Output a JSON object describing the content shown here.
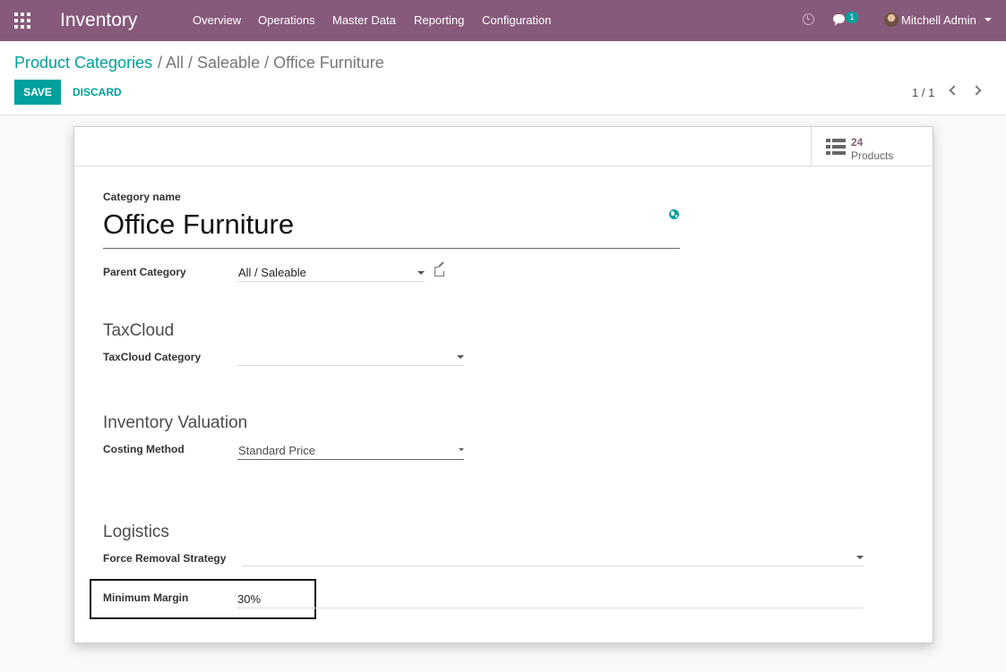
{
  "topbar": {
    "app_name": "Inventory",
    "menus": [
      "Overview",
      "Operations",
      "Master Data",
      "Reporting",
      "Configuration"
    ],
    "message_badge": "1",
    "user": "Mitchell Admin"
  },
  "breadcrumb": {
    "parent": "Product Categories",
    "current": "/ All / Saleable / Office Furniture"
  },
  "actions": {
    "save": "SAVE",
    "discard": "DISCARD"
  },
  "pager": "1 / 1",
  "stat_button": {
    "count": "24",
    "label": "Products"
  },
  "form": {
    "category_name_label": "Category name",
    "category_name": "Office Furniture",
    "parent_category_label": "Parent Category",
    "parent_category": "All / Saleable",
    "taxcloud_title": "TaxCloud",
    "taxcloud_category_label": "TaxCloud Category",
    "taxcloud_category": "",
    "inventory_valuation_title": "Inventory Valuation",
    "costing_method_label": "Costing Method",
    "costing_method": "Standard Price",
    "logistics_title": "Logistics",
    "force_removal_label": "Force Removal Strategy",
    "force_removal": "",
    "minimum_margin_label": "Minimum Margin",
    "minimum_margin": "30%"
  },
  "icons": [
    "apps-grid-icon",
    "clock-icon",
    "chat-icon",
    "avatar",
    "list-icon",
    "globe-icon",
    "external-link-icon",
    "chevron-left-icon",
    "chevron-right-icon",
    "dropdown-caret-icon"
  ],
  "colors": {
    "topbar": "#875a7b",
    "accent": "#00a09d",
    "stat_count": "#875a7b"
  }
}
